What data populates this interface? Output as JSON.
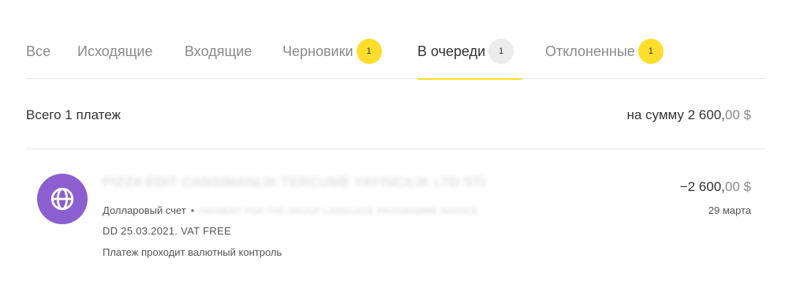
{
  "tabs": [
    {
      "label": "Все"
    },
    {
      "label": "Исходящие"
    },
    {
      "label": "Входящие"
    },
    {
      "label": "Черновики",
      "badge": "1"
    },
    {
      "label": "В очереди",
      "badge": "1"
    },
    {
      "label": "Отклоненные",
      "badge": "1"
    }
  ],
  "active_tab": "В очереди",
  "summary": {
    "total": "Всего 1 платеж",
    "sum_prefix": "на сумму 2 600,",
    "sum_cents": "00 $"
  },
  "payment": {
    "icon": "globe-icon",
    "payee": "PIZZA EDIT CANSIMANLIK TERCUME YAYINCILIK LTD STI",
    "account": "Долларовый счет",
    "separator": "•",
    "purpose": "PAYMENT FOR THE GROUP LANGUAGE PROGRAMME INVOICE",
    "details": "DD 25.03.2021. VAT FREE",
    "status": "Платеж проходит валютный контроль",
    "amount_main": "−2 600,",
    "amount_cents": "00 $",
    "date": "29 марта"
  },
  "colors": {
    "accent": "#ffdd2d",
    "badge_inactive": "#ececec",
    "avatar": "#8b5fcf"
  }
}
